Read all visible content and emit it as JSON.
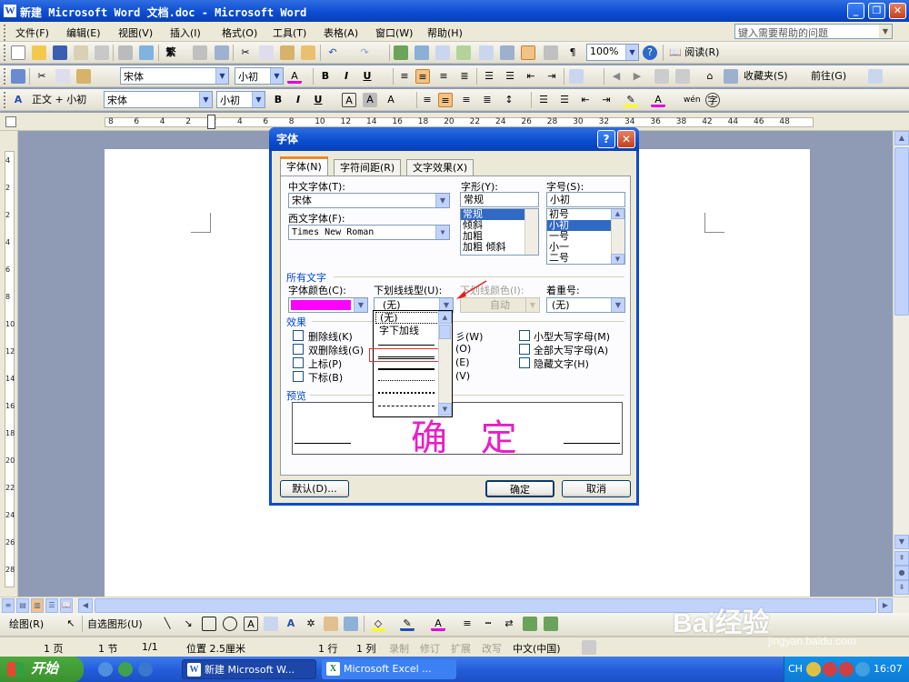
{
  "window": {
    "title": "新建 Microsoft Word 文档.doc - Microsoft Word",
    "minimize": "_",
    "restore": "❐",
    "close": "✕"
  },
  "menu": {
    "items": [
      "文件(F)",
      "编辑(E)",
      "视图(V)",
      "插入(I)",
      "格式(O)",
      "工具(T)",
      "表格(A)",
      "窗口(W)",
      "帮助(H)"
    ],
    "help_placeholder": "键入需要帮助的问题"
  },
  "toolbar1": {
    "zoom": "100%",
    "read": "阅读(R)",
    "traditional": "繁"
  },
  "toolbar2": {
    "font": "宋体",
    "size": "小初",
    "bold": "B",
    "italic": "I",
    "underline": "U",
    "favorites": "收藏夹(S)",
    "goto": "前往(G)"
  },
  "toolbar3": {
    "style": "正文 + 小初",
    "font": "宋体",
    "size": "小初",
    "bold": "B",
    "italic": "I",
    "underline": "U"
  },
  "ruler_numbers": [
    "8",
    "6",
    "4",
    "2",
    "2",
    "4",
    "6",
    "8",
    "10",
    "12",
    "14",
    "16",
    "18",
    "20",
    "22",
    "24",
    "26",
    "28",
    "30",
    "32",
    "34",
    "36",
    "38",
    "42",
    "44",
    "46",
    "48"
  ],
  "vruler_numbers": [
    "4",
    "2",
    "2",
    "4",
    "6",
    "8",
    "10",
    "12",
    "14",
    "16",
    "18",
    "20",
    "22",
    "24",
    "26",
    "28"
  ],
  "dialog": {
    "title": "字体",
    "help": "?",
    "close": "✕",
    "tabs": [
      "字体(N)",
      "字符间距(R)",
      "文字效果(X)"
    ],
    "cn_font_label": "中文字体(T):",
    "cn_font_value": "宋体",
    "west_font_label": "西文字体(F):",
    "west_font_value": "Times New Roman",
    "style_label": "字形(Y):",
    "style_value": "常规",
    "style_options": [
      "常规",
      "倾斜",
      "加粗",
      "加粗 倾斜"
    ],
    "size_label": "字号(S):",
    "size_value": "小初",
    "size_options": [
      "初号",
      "小初",
      "一号",
      "小一",
      "二号"
    ],
    "all_text_label": "所有文字",
    "color_label": "字体颜色(C):",
    "color_value": "#ff00ff",
    "underline_label": "下划线线型(U):",
    "underline_value": "(无)",
    "underline_color_label": "下划线颜色(I):",
    "underline_color_value": "自动",
    "emphasis_label": "着重号:",
    "emphasis_value": "(无)",
    "underline_options": [
      "(无)",
      "字下加线"
    ],
    "effects_label": "效果",
    "effects_left": [
      "删除线(K)",
      "双删除线(G)",
      "上标(P)",
      "下标(B)"
    ],
    "effects_mid_partial": [
      "彡(W)",
      "(O)",
      "(E)",
      "(V)"
    ],
    "effects_right": [
      "小型大写字母(M)",
      "全部大写字母(A)",
      "隐藏文字(H)"
    ],
    "preview_label": "预览",
    "preview_text": "确 定",
    "default_btn": "默认(D)...",
    "ok_btn": "确定",
    "cancel_btn": "取消"
  },
  "status": {
    "page": "1 页",
    "section": "1 节",
    "pages": "1/1",
    "position": "位置 2.5厘米",
    "line": "1 行",
    "col": "1 列",
    "rec": "录制",
    "trk": "修订",
    "ext": "扩展",
    "ovr": "改写",
    "lang": "中文(中国)"
  },
  "drawbar": {
    "draw": "绘图(R)",
    "autoshapes": "自选图形(U)"
  },
  "taskbar": {
    "start": "开始",
    "task1": "新建 Microsoft W...",
    "task2": "Microsoft Excel ...",
    "tray_lang": "CH",
    "clock": "16:07"
  },
  "watermark": {
    "brand": "Bai经验",
    "url": "jingyan.baidu.com"
  }
}
